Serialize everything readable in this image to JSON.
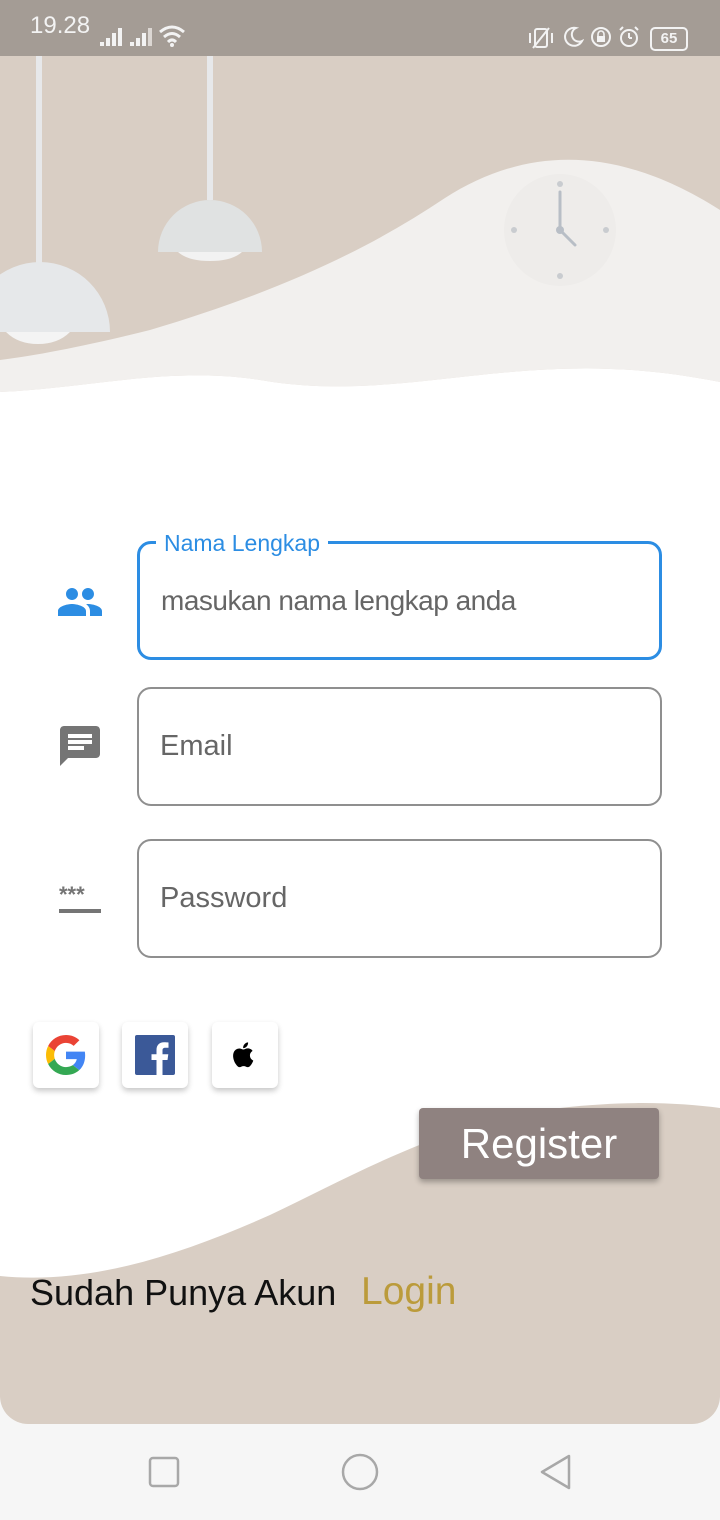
{
  "status_bar": {
    "time": "19.28",
    "battery": "65"
  },
  "form": {
    "name": {
      "label": "Nama Lengkap",
      "placeholder": "masukan nama lengkap anda",
      "icon": "people-icon"
    },
    "email": {
      "placeholder": "Email",
      "icon": "message-icon"
    },
    "password": {
      "placeholder": "Password",
      "icon": "password-icon"
    }
  },
  "social_login": [
    "google-icon",
    "facebook-icon",
    "apple-icon"
  ],
  "register_label": "Register",
  "footer": {
    "prompt": "Sudah Punya Akun",
    "login_label": "Login"
  },
  "nav": [
    "recents-icon",
    "home-icon",
    "back-icon"
  ],
  "colors": {
    "accent": "#2c8de3",
    "register_button": "#8f8280",
    "login_link": "#bb9b3b",
    "background_beige": "#d9cec4",
    "placeholder_orange": "#d9963e"
  }
}
